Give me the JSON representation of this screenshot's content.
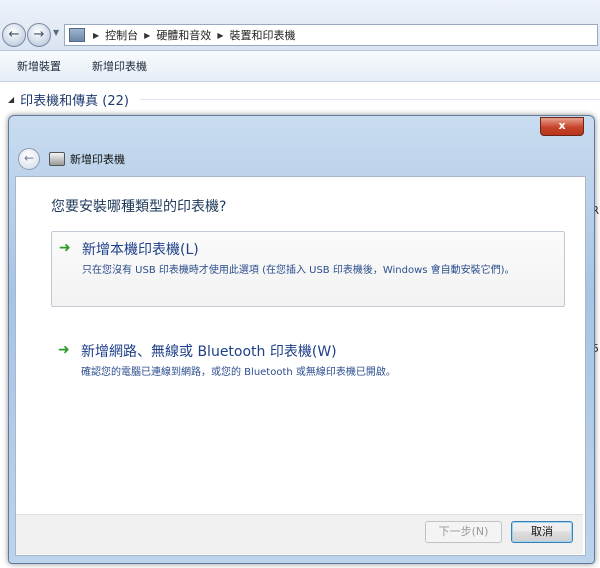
{
  "breadcrumb": [
    "控制台",
    "硬體和音效",
    "裝置和印表機"
  ],
  "commands": [
    "新增裝置",
    "新增印表機"
  ],
  "group_header": "印表機和傳真 (22)",
  "side_fragments": [
    "R",
    "5"
  ],
  "dialog": {
    "title": "新增印表機",
    "close_label": "x",
    "question": "您要安裝哪種類型的印表機?",
    "options": [
      {
        "title": "新增本機印表機(L)",
        "description": "只在您沒有 USB 印表機時才使用此選項 (在您插入 USB 印表機後，Windows 會自動安裝它們)。"
      },
      {
        "title": "新增網路、無線或 Bluetooth 印表機(W)",
        "description": "確認您的電腦已連線到網路，或您的 Bluetooth 或無線印表機已開啟。"
      }
    ],
    "next_label": "下一步(N)",
    "cancel_label": "取消"
  }
}
